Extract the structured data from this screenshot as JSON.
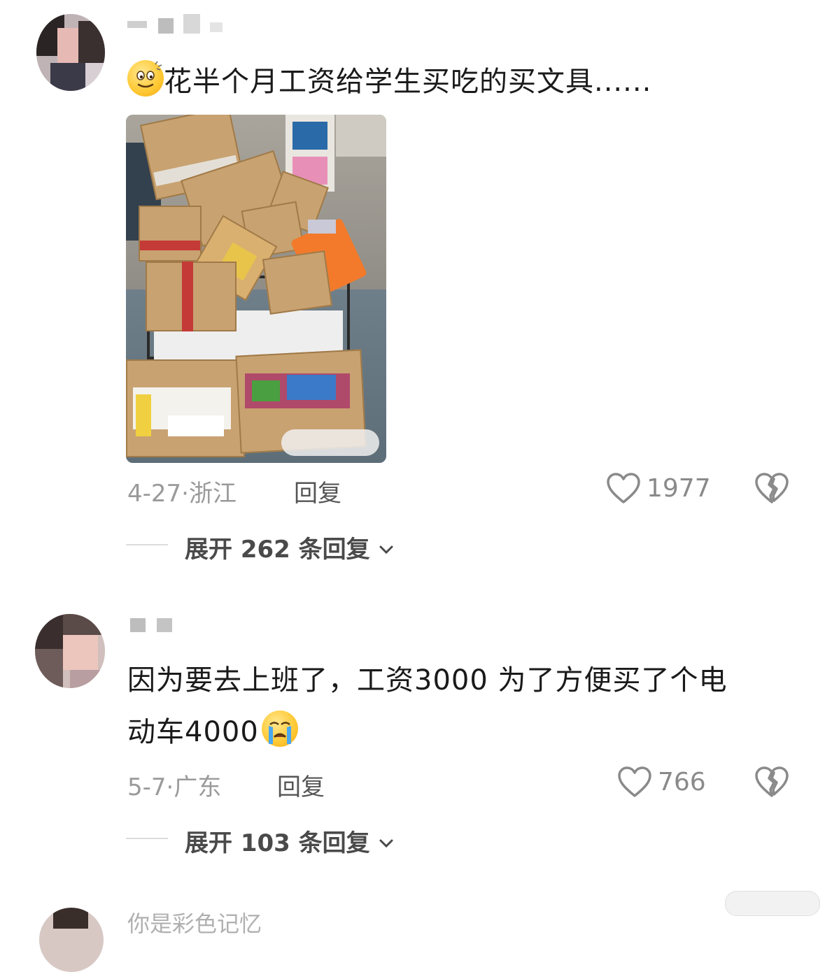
{
  "comments": [
    {
      "text": "花半个月工资给学生买吃的买文具......",
      "emoji_icon": "smiley-face-emoji",
      "date": "4-27",
      "location": "浙江",
      "reply_label": "回复",
      "like_count": "1977",
      "expand_label": "展开 262 条回复"
    },
    {
      "text_line1": "因为要去上班了，工资3000 为了方便买了个电",
      "text_line2": "动车4000",
      "emoji_icon": "crying-face-emoji",
      "date": "5-7",
      "location": "广东",
      "reply_label": "回复",
      "like_count": "766",
      "expand_label": "展开 103 条回复"
    },
    {
      "partial_text": "你是彩色记忆"
    }
  ],
  "colors": {
    "text": "#1a1a1a",
    "meta": "#9a9a9a",
    "reply": "#555555",
    "expand": "#4a4a4a"
  }
}
